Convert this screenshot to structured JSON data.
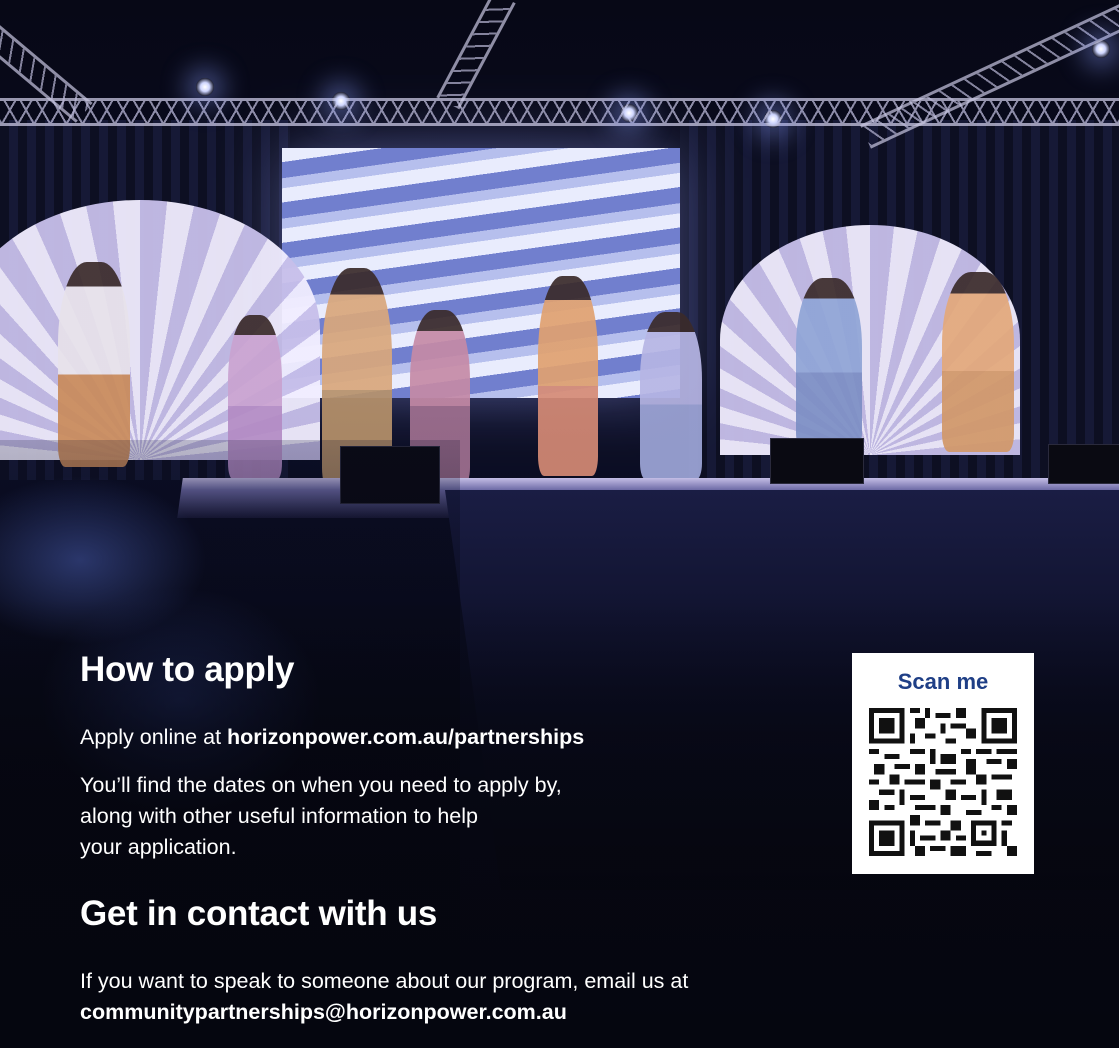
{
  "apply": {
    "heading": "How to apply",
    "online_prefix": "Apply online at ",
    "online_link": "horizonpower.com.au/partnerships",
    "dates_line1": "You’ll find the dates on when you need to apply by,",
    "dates_line2": "along with other useful information to help",
    "dates_line3": "your application."
  },
  "qr": {
    "label": "Scan me",
    "label_color": "#1f3f86"
  },
  "contact": {
    "heading": "Get in contact with us",
    "text": "If you want to speak to someone about our program, email us at",
    "email": "communitypartnerships@horizonpower.com.au"
  },
  "colors": {
    "background": "#05060f",
    "text": "#ffffff"
  }
}
